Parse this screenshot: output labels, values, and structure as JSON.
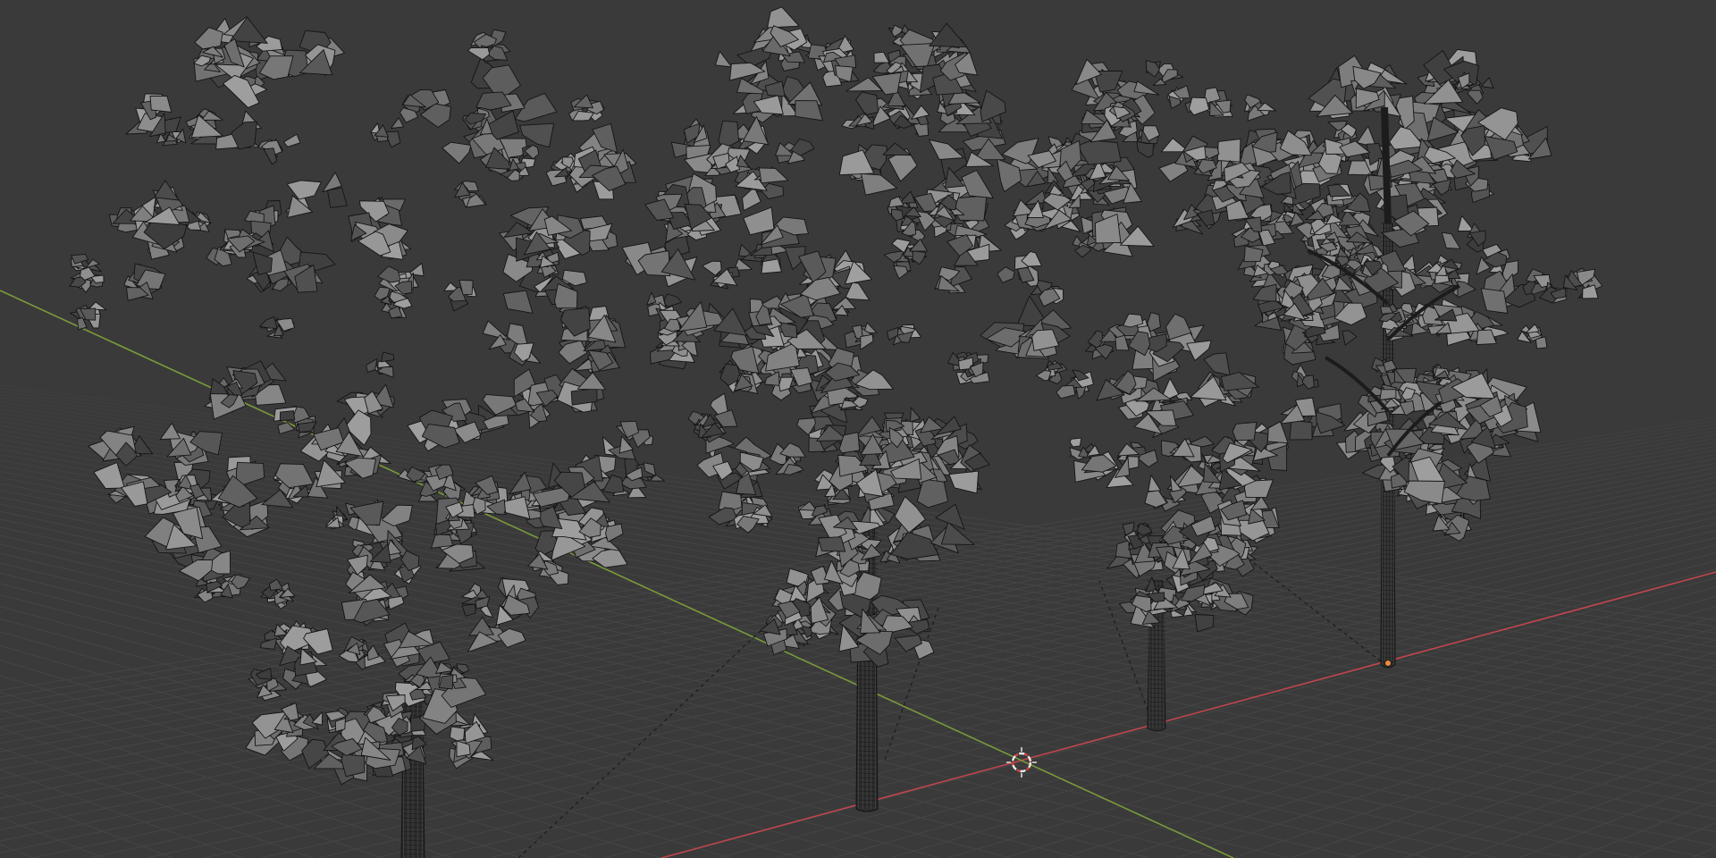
{
  "app": "3D viewport",
  "viewport": {
    "shading": "wireframe",
    "background_color": "#3a3a3a",
    "grid_color": "#454545",
    "x_axis_color": "#c0464e",
    "y_axis_color": "#7a9a3a",
    "origin_color": "#f08a3a"
  },
  "scene": {
    "objects": [
      {
        "name": "tree",
        "selected": false
      },
      {
        "name": "tree",
        "selected": false
      },
      {
        "name": "tree",
        "selected": false
      },
      {
        "name": "tree",
        "selected": true
      }
    ],
    "foliage_color": "#5a5a5a",
    "wire_color": "#141414",
    "trunk_color": "#2c2c2c"
  },
  "cursor_3d": {
    "visible": true
  }
}
